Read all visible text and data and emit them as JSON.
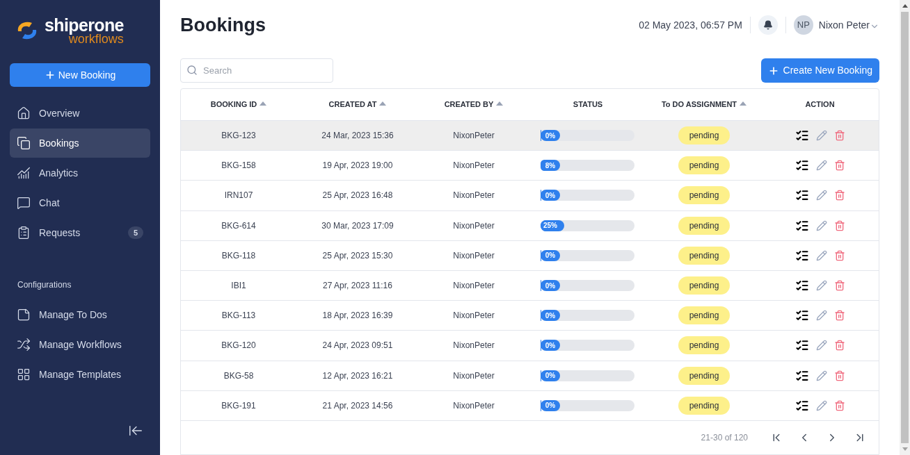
{
  "sidebar": {
    "logo": {
      "name": "shiperone",
      "tagline": "workflows"
    },
    "new_button": "New Booking",
    "items": [
      {
        "label": "Overview",
        "selected": false
      },
      {
        "label": "Bookings",
        "selected": true
      },
      {
        "label": "Analytics",
        "selected": false
      },
      {
        "label": "Chat",
        "selected": false
      },
      {
        "label": "Requests",
        "selected": false,
        "badge": "5"
      }
    ],
    "section_title": "Configurations",
    "config_items": [
      {
        "label": "Manage To Dos",
        "selected": false
      },
      {
        "label": "Manage Workflows",
        "selected": false
      },
      {
        "label": "Manage Templates",
        "selected": false
      }
    ]
  },
  "header": {
    "title": "Bookings",
    "datetime": "02 May 2023, 06:57 PM",
    "user": {
      "initials": "NP",
      "name": "Nixon Peter"
    }
  },
  "search": {
    "placeholder": "Search"
  },
  "create_button": "Create New Booking",
  "table": {
    "columns": [
      {
        "label": "BOOKING ID",
        "sortable": true
      },
      {
        "label": "CREATED AT",
        "sortable": true
      },
      {
        "label": "CREATED BY",
        "sortable": true
      },
      {
        "label": "STATUS",
        "sortable": false
      },
      {
        "label": "To DO ASSIGNMENT",
        "sortable": true
      },
      {
        "label": "ACTION",
        "sortable": false
      }
    ],
    "rows": [
      {
        "id": "BKG-123",
        "created_at": "24 Mar, 2023 15:36",
        "created_by": "NixonPeter",
        "progress": "0%",
        "level": 0,
        "assignment": "pending",
        "selected": true
      },
      {
        "id": "BKG-158",
        "created_at": "19 Apr, 2023 19:00",
        "created_by": "NixonPeter",
        "progress": "8%",
        "level": 0.08,
        "assignment": "pending",
        "selected": false
      },
      {
        "id": "IRN107",
        "created_at": "25 Apr, 2023 16:48",
        "created_by": "NixonPeter",
        "progress": "0%",
        "level": 0,
        "assignment": "pending",
        "selected": false
      },
      {
        "id": "BKG-614",
        "created_at": "30 Mar, 2023 17:09",
        "created_by": "NixonPeter",
        "progress": "25%",
        "level": 0.25,
        "assignment": "pending",
        "selected": false
      },
      {
        "id": "BKG-118",
        "created_at": "25 Apr, 2023 15:30",
        "created_by": "NixonPeter",
        "progress": "0%",
        "level": 0,
        "assignment": "pending",
        "selected": false
      },
      {
        "id": "IBI1",
        "created_at": "27 Apr, 2023 11:16",
        "created_by": "NixonPeter",
        "progress": "0%",
        "level": 0,
        "assignment": "pending",
        "selected": false
      },
      {
        "id": "BKG-113",
        "created_at": "18 Apr, 2023 16:39",
        "created_by": "NixonPeter",
        "progress": "0%",
        "level": 0,
        "assignment": "pending",
        "selected": false
      },
      {
        "id": "BKG-120",
        "created_at": "24 Apr, 2023 09:51",
        "created_by": "NixonPeter",
        "progress": "0%",
        "level": 0,
        "assignment": "pending",
        "selected": false
      },
      {
        "id": "BKG-58",
        "created_at": "12 Apr, 2023 16:21",
        "created_by": "NixonPeter",
        "progress": "0%",
        "level": 0,
        "assignment": "pending",
        "selected": false
      },
      {
        "id": "BKG-191",
        "created_at": "21 Apr, 2023 14:56",
        "created_by": "NixonPeter",
        "progress": "0%",
        "level": 0,
        "assignment": "pending",
        "selected": false
      }
    ],
    "pagination": "21-30 of 120"
  }
}
